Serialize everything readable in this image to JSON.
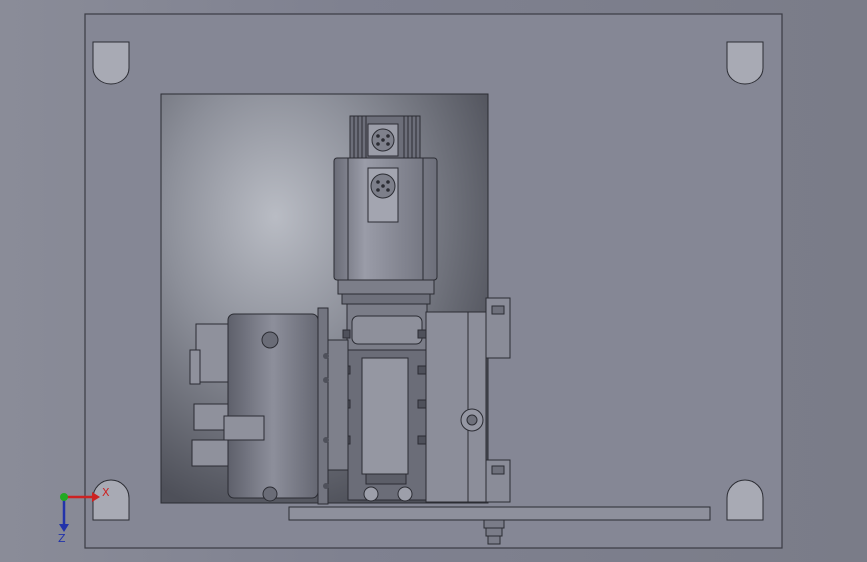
{
  "viewport": {
    "triad": {
      "x_label": "X",
      "z_label": "Z",
      "x_color": "#cc2222",
      "y_color": "#22aa22",
      "z_color": "#2233aa"
    }
  },
  "colors": {
    "background": "#7f8190",
    "plate": "#858795",
    "plate_edge": "#3a3b44",
    "part": "#8b8d99",
    "part_dark": "#5a5c66",
    "outline": "#2b2c33"
  },
  "parts": {
    "base_plate": "base-plate",
    "pocket": "recessed-pocket",
    "motor": "servo-motor",
    "gearbox": "gearbox",
    "chuck": "three-jaw-chuck",
    "bracket": "mounting-bracket",
    "rail": "bottom-rail"
  },
  "icons": {
    "corner_slots": "mounting-slot-icon",
    "connector": "connector-icon"
  }
}
